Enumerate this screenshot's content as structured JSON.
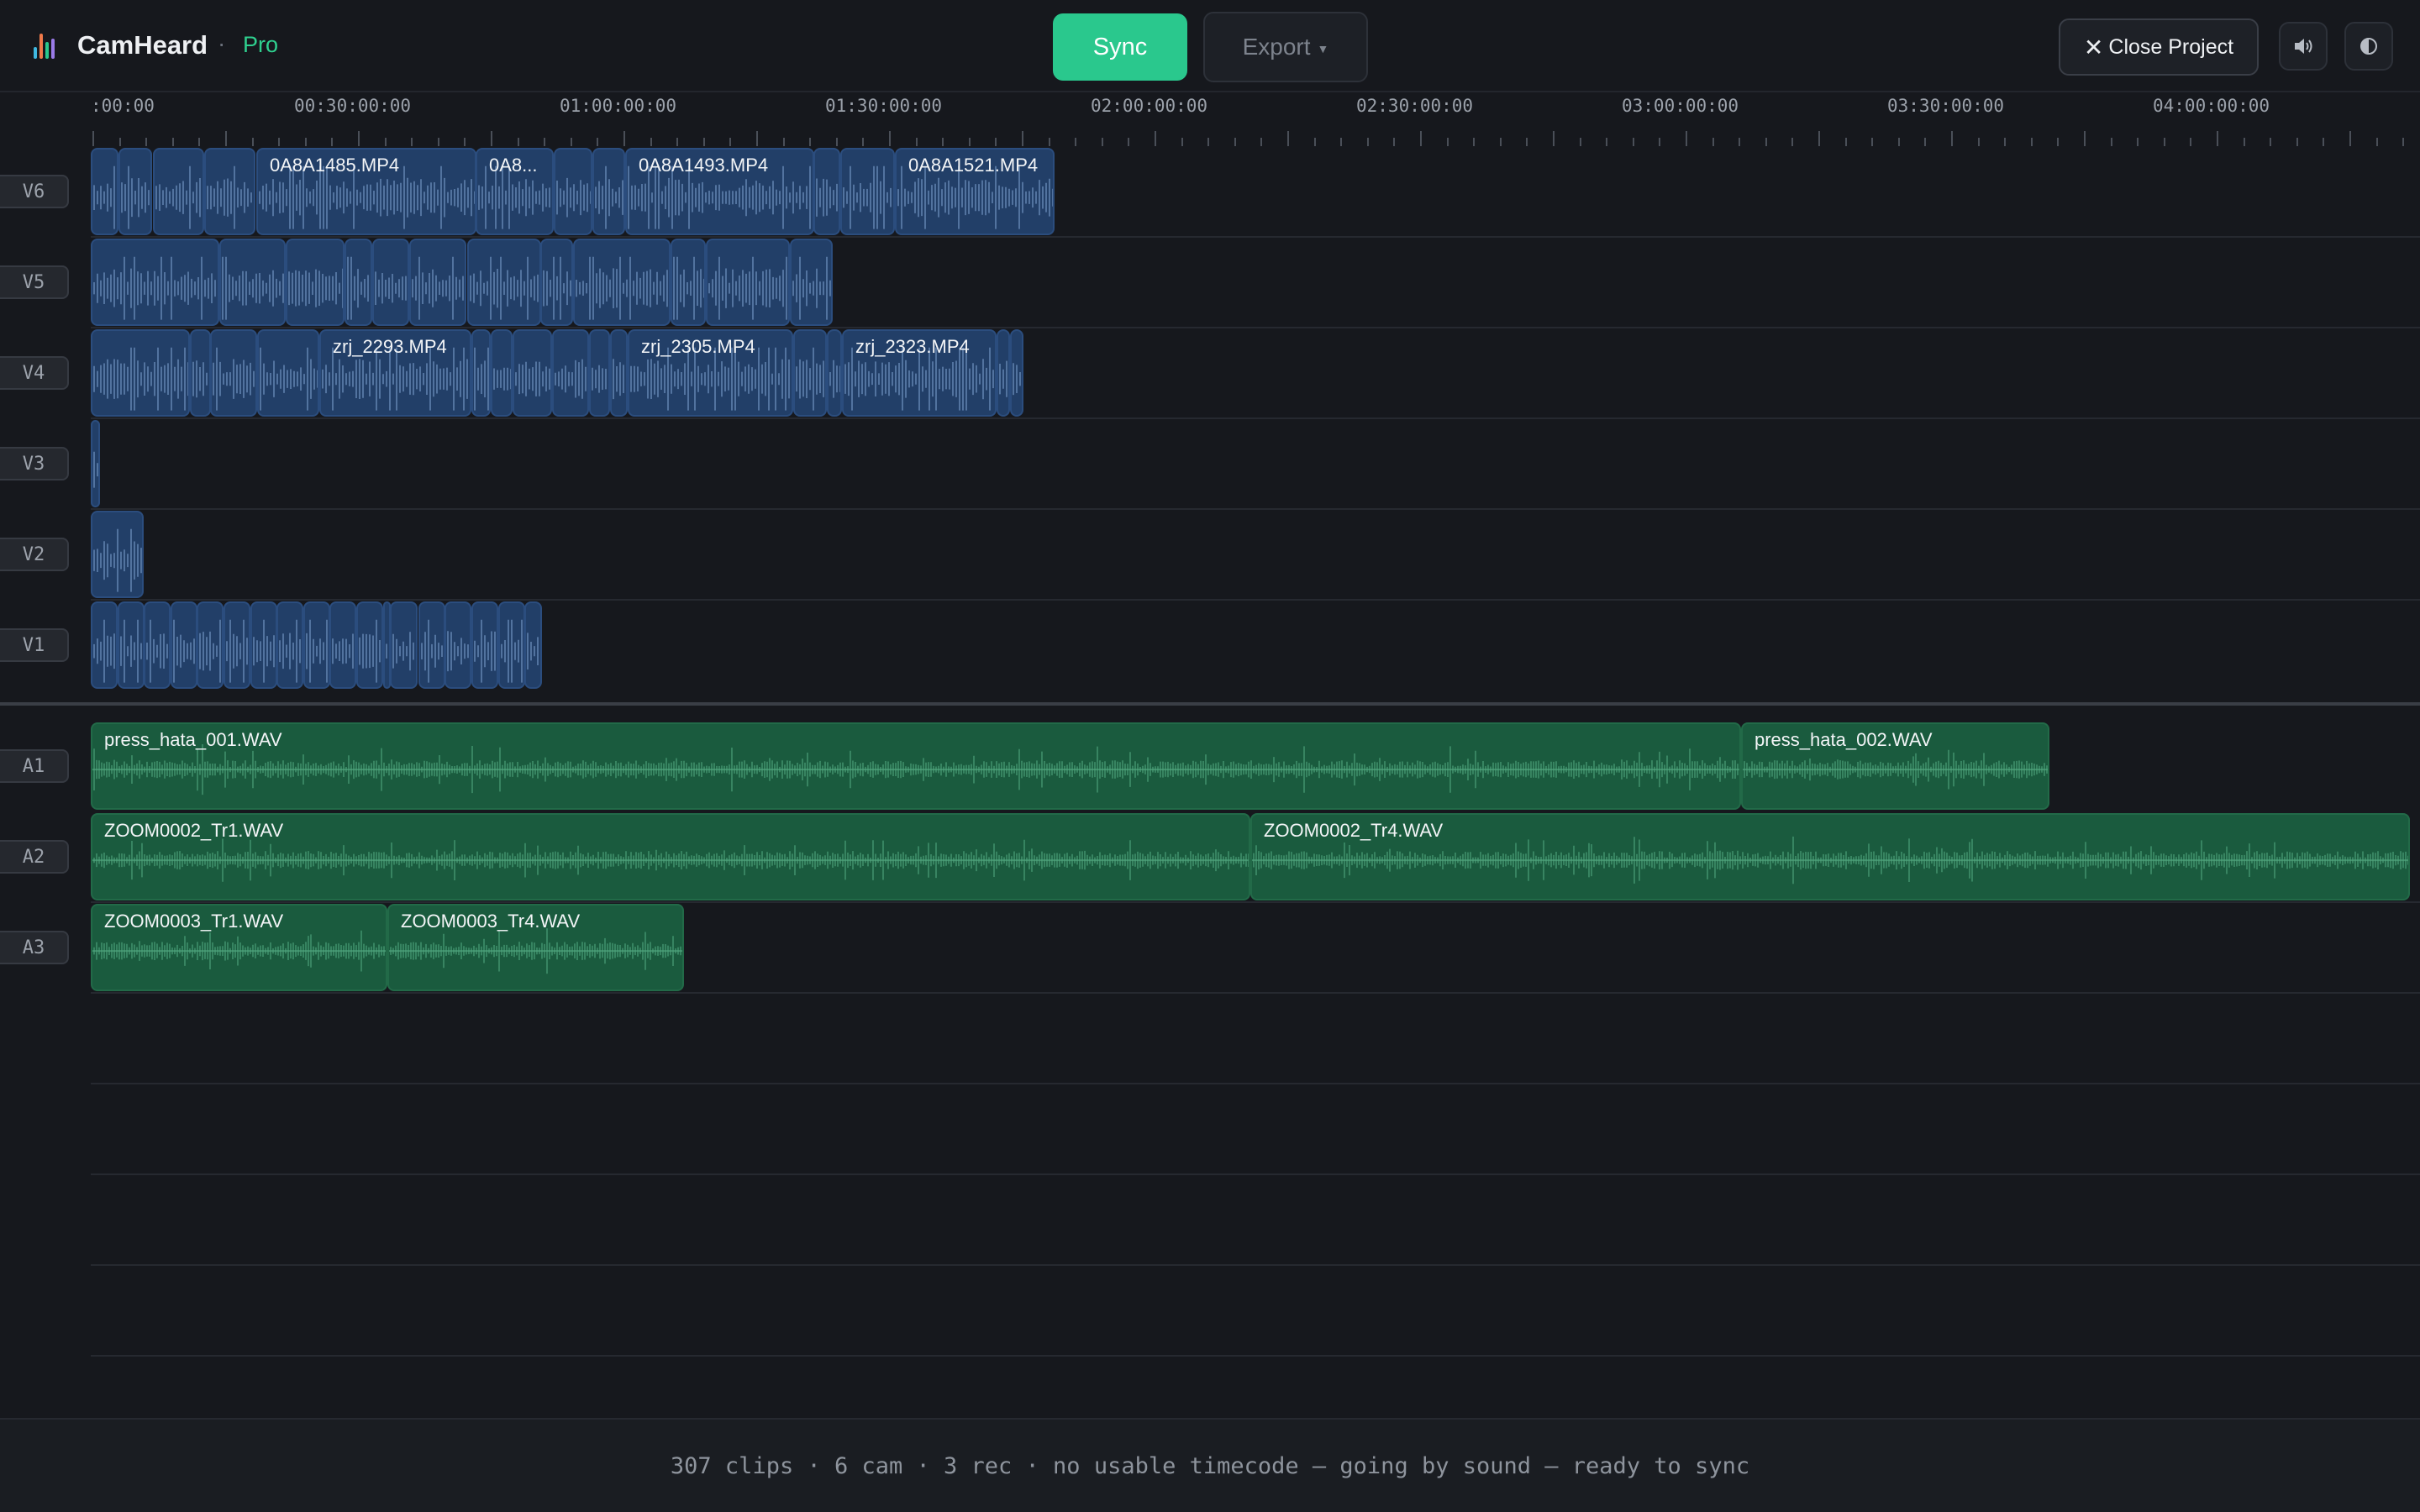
{
  "app": {
    "name": "CamHeard",
    "separator": "·",
    "plan": "Pro"
  },
  "toolbar": {
    "sync_label": "Sync",
    "export_label": "Export",
    "close_label": "Close Project",
    "volume_icon": "speaker-icon",
    "theme_icon": "contrast-icon"
  },
  "ruler": {
    "labels": [
      ":00:00",
      "00:30:00:00",
      "01:00:00:00",
      "01:30:00:00",
      "02:00:00:00",
      "02:30:00:00",
      "03:00:00:00",
      "03:30:00:00",
      "04:00:00:00"
    ]
  },
  "colors": {
    "accent": "#2ac88d",
    "video_clip": "#223f68",
    "audio_clip": "#1a5b3e",
    "video_wave": "#6d8fbd",
    "audio_wave": "#4fa57d"
  },
  "tracks": [
    {
      "label": "V6",
      "kind": "video",
      "clips": [
        {
          "start": "00:00:00:00",
          "end": "00:03:10:00",
          "name": ""
        },
        {
          "start": "00:03:10:00",
          "end": "00:07:00:00",
          "name": ""
        },
        {
          "start": "00:07:00:00",
          "end": "00:12:50:00",
          "name": ""
        },
        {
          "start": "00:12:50:00",
          "end": "00:18:40:00",
          "name": ""
        },
        {
          "start": "00:18:40:00",
          "end": "00:43:30:00",
          "name": "0A8A1485.MP4"
        },
        {
          "start": "00:43:30:00",
          "end": "00:52:20:00",
          "name": "0A8..."
        },
        {
          "start": "00:52:20:00",
          "end": "00:56:40:00",
          "name": ""
        },
        {
          "start": "00:56:40:00",
          "end": "01:00:20:00",
          "name": ""
        },
        {
          "start": "01:00:20:00",
          "end": "01:21:40:00",
          "name": "0A8A1493.MP4"
        },
        {
          "start": "01:21:40:00",
          "end": "01:24:40:00",
          "name": ""
        },
        {
          "start": "01:24:40:00",
          "end": "01:30:50:00",
          "name": ""
        },
        {
          "start": "01:30:50:00",
          "end": "01:48:50:00",
          "name": "0A8A1521.MP4"
        }
      ]
    },
    {
      "label": "V5",
      "kind": "video",
      "clips": [
        {
          "start": "00:00:00:00",
          "end": "00:14:30:00",
          "name": ""
        },
        {
          "start": "00:14:30:00",
          "end": "00:22:00:00",
          "name": ""
        },
        {
          "start": "00:22:00:00",
          "end": "00:28:40:00",
          "name": ""
        },
        {
          "start": "00:28:40:00",
          "end": "00:31:50:00",
          "name": ""
        },
        {
          "start": "00:31:50:00",
          "end": "00:36:00:00",
          "name": ""
        },
        {
          "start": "00:36:00:00",
          "end": "00:42:30:00",
          "name": ""
        },
        {
          "start": "00:42:30:00",
          "end": "00:50:50:00",
          "name": ""
        },
        {
          "start": "00:50:50:00",
          "end": "00:54:30:00",
          "name": ""
        },
        {
          "start": "00:54:30:00",
          "end": "01:05:30:00",
          "name": ""
        },
        {
          "start": "01:05:30:00",
          "end": "01:09:30:00",
          "name": ""
        },
        {
          "start": "01:09:30:00",
          "end": "01:19:00:00",
          "name": ""
        },
        {
          "start": "01:19:00:00",
          "end": "01:23:50:00",
          "name": ""
        }
      ]
    },
    {
      "label": "V4",
      "kind": "video",
      "clips": [
        {
          "start": "00:00:00:00",
          "end": "00:11:10:00",
          "name": ""
        },
        {
          "start": "00:11:10:00",
          "end": "00:13:30:00",
          "name": ""
        },
        {
          "start": "00:13:30:00",
          "end": "00:18:50:00",
          "name": ""
        },
        {
          "start": "00:18:50:00",
          "end": "00:25:50:00",
          "name": ""
        },
        {
          "start": "00:25:50:00",
          "end": "00:43:00:00",
          "name": "zrj_2293.MP4"
        },
        {
          "start": "00:43:00:00",
          "end": "00:45:10:00",
          "name": ""
        },
        {
          "start": "00:45:10:00",
          "end": "00:47:40:00",
          "name": ""
        },
        {
          "start": "00:47:40:00",
          "end": "00:52:10:00",
          "name": ""
        },
        {
          "start": "00:52:10:00",
          "end": "00:56:20:00",
          "name": ""
        },
        {
          "start": "00:56:20:00",
          "end": "00:58:40:00",
          "name": ""
        },
        {
          "start": "00:58:40:00",
          "end": "01:00:40:00",
          "name": ""
        },
        {
          "start": "01:00:40:00",
          "end": "01:19:20:00",
          "name": "zrj_2305.MP4"
        },
        {
          "start": "01:19:20:00",
          "end": "01:23:10:00",
          "name": ""
        },
        {
          "start": "01:23:10:00",
          "end": "01:24:50:00",
          "name": ""
        },
        {
          "start": "01:24:50:00",
          "end": "01:42:20:00",
          "name": "zrj_2323.MP4"
        },
        {
          "start": "01:42:20:00",
          "end": "01:43:50:00",
          "name": ""
        },
        {
          "start": "01:43:50:00",
          "end": "01:45:20:00",
          "name": ""
        }
      ]
    },
    {
      "label": "V3",
      "kind": "video",
      "clips": [
        {
          "start": "00:00:00:00",
          "end": "00:01:00:00",
          "name": ""
        }
      ]
    },
    {
      "label": "V2",
      "kind": "video",
      "clips": [
        {
          "start": "00:00:00:00",
          "end": "00:06:00:00",
          "name": ""
        }
      ]
    },
    {
      "label": "V1",
      "kind": "video",
      "clips": [
        {
          "start": "00:00:00:00",
          "end": "00:03:00:00",
          "name": ""
        },
        {
          "start": "00:03:00:00",
          "end": "00:06:00:00",
          "name": ""
        },
        {
          "start": "00:06:00:00",
          "end": "00:09:00:00",
          "name": ""
        },
        {
          "start": "00:09:00:00",
          "end": "00:12:00:00",
          "name": ""
        },
        {
          "start": "00:12:00:00",
          "end": "00:15:00:00",
          "name": ""
        },
        {
          "start": "00:15:00:00",
          "end": "00:18:00:00",
          "name": ""
        },
        {
          "start": "00:18:00:00",
          "end": "00:21:00:00",
          "name": ""
        },
        {
          "start": "00:21:00:00",
          "end": "00:24:00:00",
          "name": ""
        },
        {
          "start": "00:24:00:00",
          "end": "00:27:00:00",
          "name": ""
        },
        {
          "start": "00:27:00:00",
          "end": "00:30:00:00",
          "name": ""
        },
        {
          "start": "00:30:00:00",
          "end": "00:33:00:00",
          "name": ""
        },
        {
          "start": "00:33:00:00",
          "end": "00:33:50:00",
          "name": ""
        },
        {
          "start": "00:33:50:00",
          "end": "00:37:00:00",
          "name": ""
        },
        {
          "start": "00:37:00:00",
          "end": "00:40:00:00",
          "name": ""
        },
        {
          "start": "00:40:00:00",
          "end": "00:43:00:00",
          "name": ""
        },
        {
          "start": "00:43:00:00",
          "end": "00:46:00:00",
          "name": ""
        },
        {
          "start": "00:46:00:00",
          "end": "00:49:00:00",
          "name": ""
        },
        {
          "start": "00:49:00:00",
          "end": "00:51:00:00",
          "name": ""
        }
      ]
    },
    {
      "label": "A1",
      "kind": "audio",
      "clips": [
        {
          "start": "00:00:00:00",
          "end": "03:06:30:00",
          "name": "press_hata_001.WAV"
        },
        {
          "start": "03:06:30:00",
          "end": "03:41:20:00",
          "name": "press_hata_002.WAV"
        }
      ]
    },
    {
      "label": "A2",
      "kind": "audio",
      "clips": [
        {
          "start": "00:00:00:00",
          "end": "02:11:00:00",
          "name": "ZOOM0002_Tr1.WAV"
        },
        {
          "start": "02:11:00:00",
          "end": "04:22:00:00",
          "name": "ZOOM0002_Tr4.WAV"
        }
      ]
    },
    {
      "label": "A3",
      "kind": "audio",
      "clips": [
        {
          "start": "00:00:00:00",
          "end": "00:33:30:00",
          "name": "ZOOM0003_Tr1.WAV"
        },
        {
          "start": "00:33:30:00",
          "end": "01:07:00:00",
          "name": "ZOOM0003_Tr4.WAV"
        }
      ]
    }
  ],
  "status": {
    "text": "307 clips · 6 cam · 3 rec · no usable timecode — going by sound — ready to sync"
  }
}
